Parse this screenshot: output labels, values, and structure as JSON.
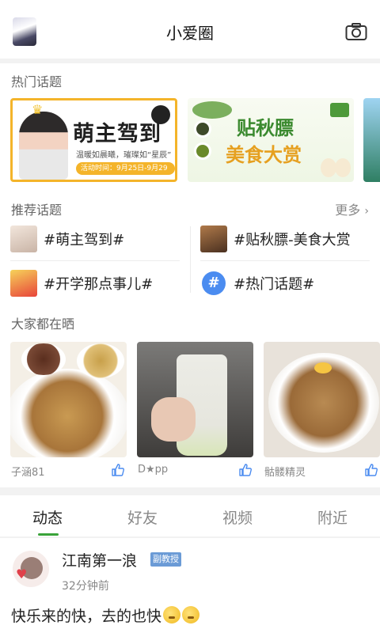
{
  "header": {
    "title": "小爱圈",
    "avatar_icon": "user-avatar",
    "camera_icon": "camera-icon"
  },
  "hot_topics": {
    "title": "热门话题",
    "banners": [
      {
        "headline": "萌主驾到",
        "subline": "温暖如晨曦，璀璨如“星辰”",
        "date": "活动时间：9月25日-9月29日"
      },
      {
        "headline": "贴秋膘",
        "subline": "美食大赏"
      }
    ]
  },
  "recommended_topics": {
    "title": "推荐话题",
    "more": "更多",
    "items": [
      {
        "label": "#萌主驾到#",
        "thumb_color": "#e8d8d0"
      },
      {
        "label": "#贴秋膘-美食大赏",
        "thumb_color": "#7a5a3a"
      },
      {
        "label": "#开学那点事儿#",
        "thumb_color": "#e84a3a"
      },
      {
        "label": "#热门话题#",
        "thumb_icon": "hash-icon"
      }
    ]
  },
  "feed": {
    "title": "大家都在晒",
    "photos": [
      {
        "user": "子涵81"
      },
      {
        "user": "D★pp"
      },
      {
        "user": "骷髅精灵"
      }
    ]
  },
  "tabs": [
    "动态",
    "好友",
    "视频",
    "附近"
  ],
  "active_tab": 0,
  "post": {
    "name": "江南第一浪",
    "badge": "副教授",
    "time": "32分钟前",
    "text": "快乐来的快，去的也快"
  },
  "colors": {
    "accent_green": "#3aa33a",
    "hash_blue": "#4b8cf0",
    "badge_blue": "#6b9bd6"
  }
}
